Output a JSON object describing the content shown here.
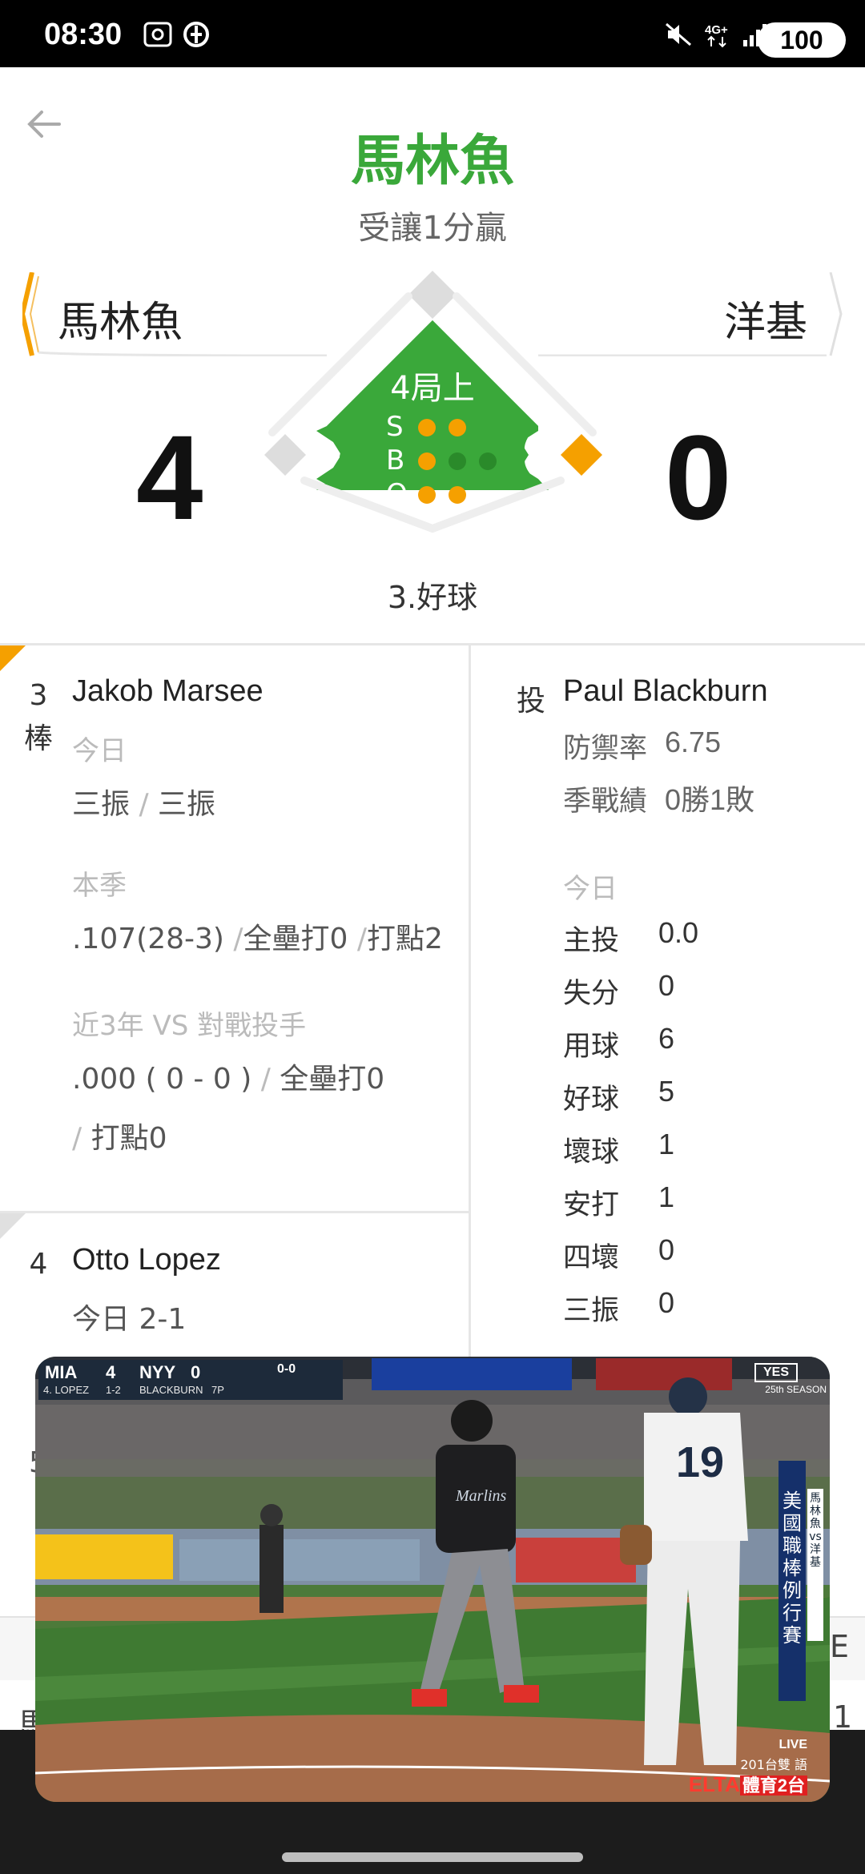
{
  "status_bar": {
    "time": "08:30",
    "battery": "100",
    "network": "4G+"
  },
  "header": {
    "title": "馬林魚",
    "subtitle": "受讓1分贏"
  },
  "scoreboard": {
    "away_team": "馬林魚",
    "home_team": "洋基",
    "away_score": "4",
    "home_score": "0",
    "inning": "4局上",
    "count_labels": [
      "S",
      "B",
      "O"
    ],
    "strikes": 2,
    "balls": 1,
    "outs": 2,
    "last_pitch": "3.好球"
  },
  "batter": {
    "order_num": "3",
    "order_suffix": "棒",
    "name": "Jakob Marsee",
    "today_label": "今日",
    "today_results": [
      "三振",
      "三振"
    ],
    "season_label": "本季",
    "season_avg": ".107(28-3)",
    "season_hr": "全壘打0",
    "season_rbi": "打點2",
    "vs_label": "近3年 VS 對戰投手",
    "vs_avg": ".000 ( 0 - 0 )",
    "vs_hr": "全壘打0",
    "vs_rbi": "打點0"
  },
  "next_batter": {
    "order_num": "4",
    "name": "Otto Lopez",
    "today": "今日 2-1",
    "partial_order": "5"
  },
  "pitcher": {
    "label": "投",
    "name": "Paul Blackburn",
    "era_label": "防禦率",
    "era": "6.75",
    "record_label": "季戰績",
    "record": "0勝1敗",
    "today_label": "今日",
    "stats": [
      {
        "label": "主投",
        "value": "0.0"
      },
      {
        "label": "失分",
        "value": "0"
      },
      {
        "label": "用球",
        "value": "6"
      },
      {
        "label": "好球",
        "value": "5"
      },
      {
        "label": "壞球",
        "value": "1"
      },
      {
        "label": "安打",
        "value": "1"
      },
      {
        "label": "四壞",
        "value": "0"
      },
      {
        "label": "三振",
        "value": "0"
      }
    ]
  },
  "table_fragment": {
    "left_char": "馬",
    "right_header": "E",
    "right_value": "1"
  },
  "video": {
    "away_abbr": "MIA",
    "away_score": "4",
    "home_abbr": "NYY",
    "home_score": "0",
    "count": "0-0",
    "batter_line": "4. LOPEZ",
    "batter_stat": "1-2",
    "pitcher_line": "BLACKBURN",
    "pitch_count": "7P",
    "network_logo": "YES",
    "season_tag": "25th SEASON",
    "mlb_tag": "美國職棒例行賽",
    "matchup_tag": "馬林魚vs洋基",
    "live": "LIVE",
    "channel": "201台雙 語",
    "broadcaster": "ELTA",
    "broadcaster_ch": "體育2台",
    "jersey_number": "19",
    "jersey_text": "Marlins"
  },
  "colors": {
    "accent_green": "#3aa83a",
    "field_green": "#35a82a",
    "accent_orange": "#f5a000"
  }
}
